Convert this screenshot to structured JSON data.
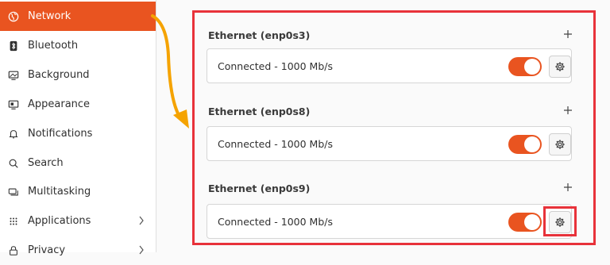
{
  "sidebar": {
    "items": [
      {
        "label": "Network",
        "icon": "network-icon",
        "active": true
      },
      {
        "label": "Bluetooth",
        "icon": "bluetooth-icon"
      },
      {
        "label": "Background",
        "icon": "background-icon"
      },
      {
        "label": "Appearance",
        "icon": "appearance-icon"
      },
      {
        "label": "Notifications",
        "icon": "bell-icon"
      },
      {
        "label": "Search",
        "icon": "search-icon"
      },
      {
        "label": "Multitasking",
        "icon": "multitasking-icon"
      },
      {
        "label": "Applications",
        "icon": "grid-icon",
        "chevron": true
      },
      {
        "label": "Privacy",
        "icon": "lock-icon",
        "chevron": true
      }
    ]
  },
  "sections": [
    {
      "title": "Ethernet (enp0s3)",
      "status": "Connected - 1000 Mb/s",
      "enabled": true
    },
    {
      "title": "Ethernet (enp0s8)",
      "status": "Connected - 1000 Mb/s",
      "enabled": true
    },
    {
      "title": "Ethernet (enp0s9)",
      "status": "Connected - 1000 Mb/s",
      "enabled": true
    }
  ],
  "colors": {
    "accent": "#e95420",
    "highlight": "#e8323a",
    "arrow": "#f5a300"
  }
}
